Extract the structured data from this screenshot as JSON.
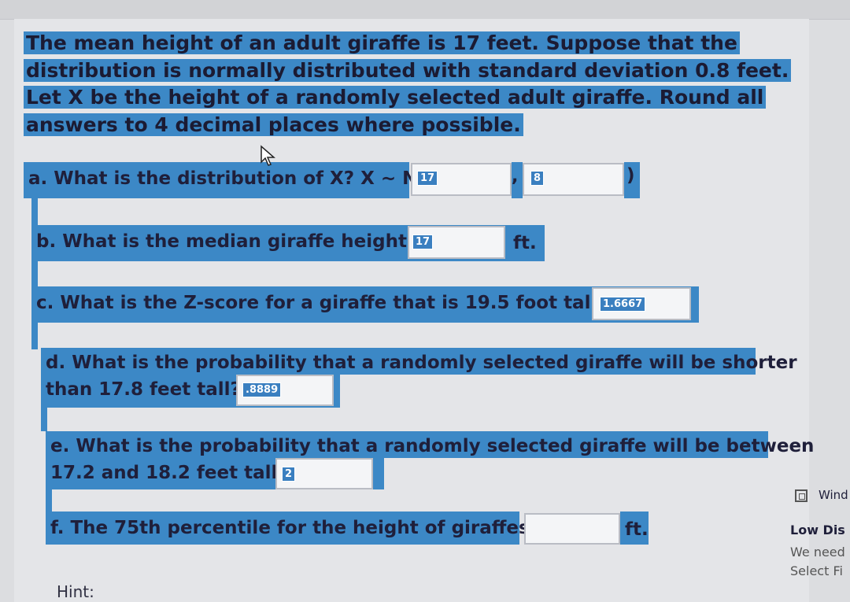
{
  "intro_text": "The mean height of an adult giraffe is 17 feet. Suppose that the distribution is normally distributed with standard deviation 0.8 feet. Let X be the height of a randomly selected adult giraffe. Round all answers to 4 decimal places where possible.",
  "questions": {
    "a": {
      "text": "a. What is the distribution of X? X ~ N(",
      "answer1": "17",
      "separator": ",",
      "answer2": "8",
      "close": ")"
    },
    "b": {
      "text": "b. What is the median giraffe height?",
      "answer": "17",
      "unit": "ft."
    },
    "c": {
      "text": "c. What is the Z-score for a giraffe that is 19.5 foot tall?",
      "answer": "1.6667"
    },
    "d": {
      "line1": "d. What is the probability that a randomly selected giraffe will be shorter",
      "line2": "than 17.8 feet tall?",
      "answer": ".8889"
    },
    "e": {
      "line1": "e. What is the probability that a randomly selected giraffe will be between",
      "line2": "17.2 and 18.2 feet tall?",
      "answer": "2"
    },
    "f": {
      "text": "f. The 75th percentile for the height of giraffes is",
      "answer": "",
      "unit": "ft."
    }
  },
  "hint_label": "Hint:",
  "side_panel": {
    "title": "Wind",
    "heading": "Low Dis",
    "line1": "We need",
    "line2": "Select Fi"
  },
  "colors": {
    "highlight": "#3c88c6",
    "badge": "#3a7fc0",
    "background": "#e4e5e8"
  }
}
